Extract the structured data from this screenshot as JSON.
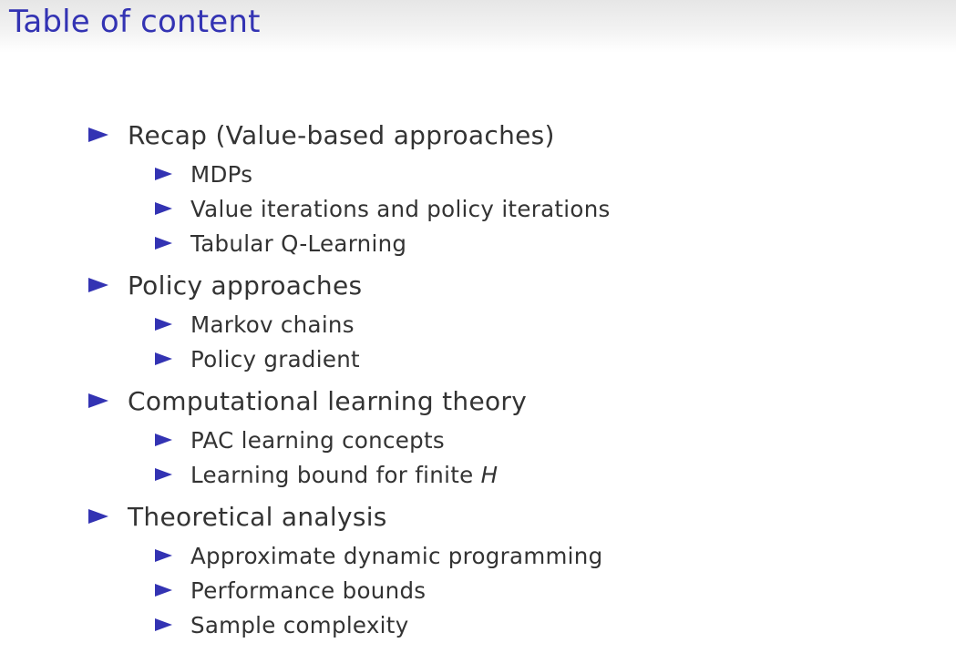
{
  "slide": {
    "title": "Table of content"
  },
  "toc": {
    "sections": [
      {
        "label": "Recap (Value-based approaches)",
        "items": [
          "MDPs",
          "Value iterations and policy iterations",
          "Tabular Q-Learning"
        ]
      },
      {
        "label": "Policy approaches",
        "items": [
          "Markov chains",
          "Policy gradient"
        ]
      },
      {
        "label": "Computational learning theory",
        "items": [
          "PAC learning concepts",
          "Learning bound for finite "
        ],
        "item_math": {
          "1": "H"
        }
      },
      {
        "label": "Theoretical analysis",
        "items": [
          "Approximate dynamic programming",
          "Performance bounds",
          "Sample complexity"
        ]
      }
    ]
  },
  "colors": {
    "accent": "#3333b3",
    "text": "#333333",
    "title_bar": "#eeeeee"
  },
  "icons": {
    "bullet": "triangle-right-icon"
  }
}
